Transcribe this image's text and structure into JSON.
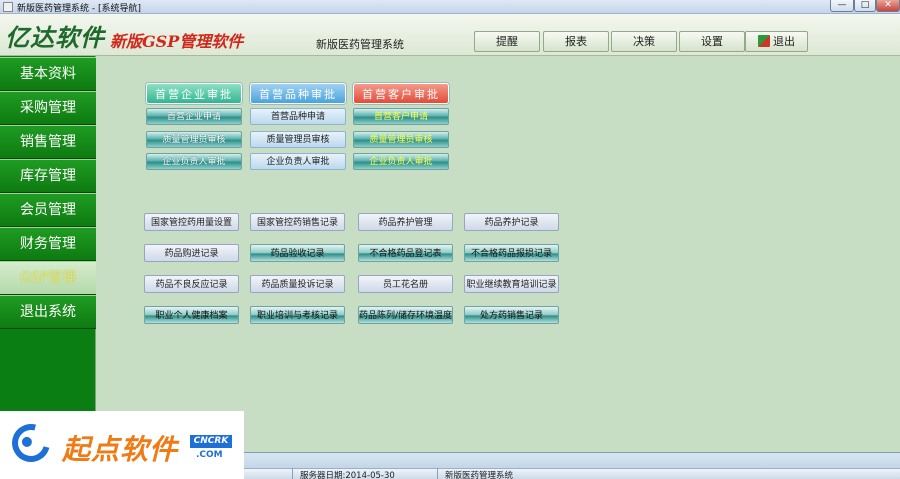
{
  "window": {
    "title": "新版医药管理系统 - [系统导航]",
    "min": "—",
    "max": "□",
    "close": "✕"
  },
  "header": {
    "logo": "亿达软件",
    "brand": "新版GSP管理软件",
    "system_name": "新版医药管理系统",
    "buttons": {
      "remind": "提醒",
      "report": "报表",
      "decision": "决策",
      "settings": "设置",
      "exit": "退出"
    }
  },
  "sidebar": {
    "items": [
      {
        "label": "基本资料"
      },
      {
        "label": "采购管理"
      },
      {
        "label": "销售管理"
      },
      {
        "label": "库存管理"
      },
      {
        "label": "会员管理"
      },
      {
        "label": "财务管理"
      },
      {
        "label": "GSP管理",
        "active": true
      },
      {
        "label": "退出系统"
      }
    ]
  },
  "approval": {
    "headers": {
      "enterprise": "首营企业审批",
      "variety": "首营品种审批",
      "customer": "首营客户审批"
    },
    "enterprise": [
      "首营企业申请",
      "质量管理员审核",
      "企业负责人审批"
    ],
    "variety": [
      "首营品种申请",
      "质量管理员审核",
      "企业负责人审批"
    ],
    "customer": [
      "首营客户申请",
      "质量管理员审核",
      "企业负责人审批"
    ]
  },
  "gsp_records": [
    [
      "国家管控药用量设置",
      "国家管控药销售记录",
      "药品养护管理",
      "药品养护记录"
    ],
    [
      "药品购进记录",
      "药品验收记录",
      "不合格药品登记表",
      "不合格药品报损记录"
    ],
    [
      "药品不良反应记录",
      "药品质量投诉记录",
      "员工花名册",
      "职业继续教育培训记录"
    ],
    [
      "职业个人健康档案",
      "职业培训与考核记录",
      "药品陈列/储存环境温度",
      "处方药销售记录"
    ]
  ],
  "status": {
    "server_date": "服务器日期:2014-05-30",
    "system": "新版医药管理系统"
  },
  "watermark": {
    "text": "起点软件",
    "badge": "CNCRK",
    "domain": ".COM",
    "suffix": "​"
  }
}
